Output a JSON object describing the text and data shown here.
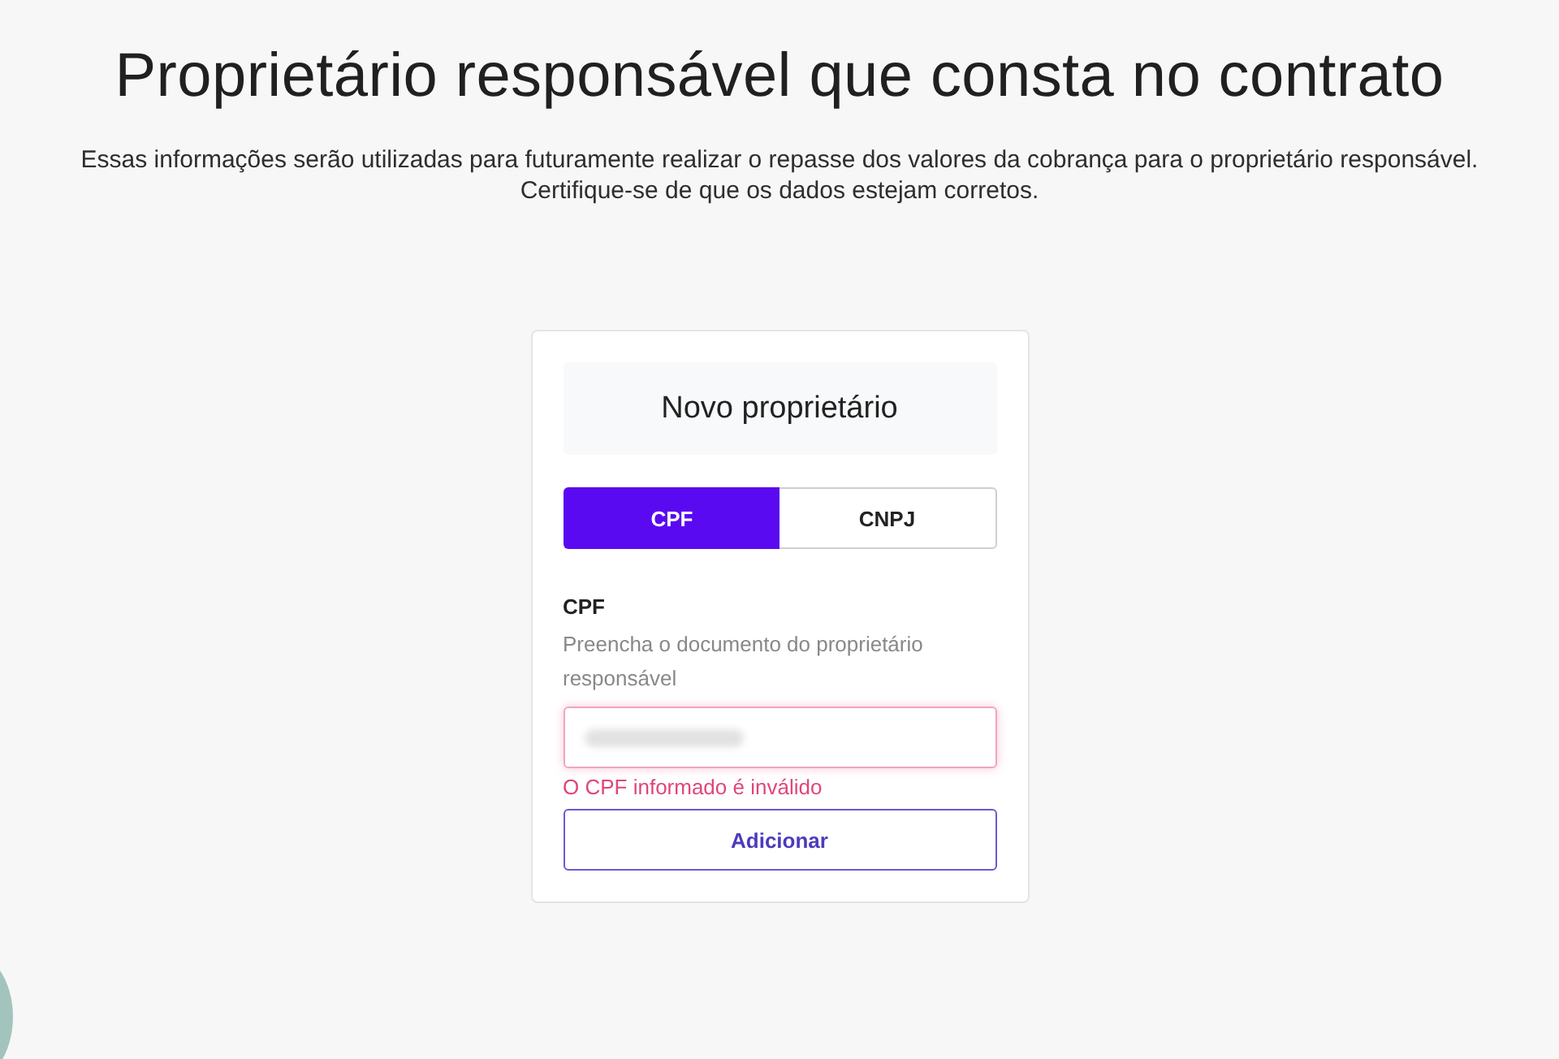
{
  "page": {
    "title": "Proprietário responsável que consta no contrato",
    "description": [
      "Essas informações serão utilizadas para futuramente realizar o repasse dos valores da cobrança para o proprietário responsável.",
      "Certifique-se de que os dados estejam corretos."
    ]
  },
  "card": {
    "title": "Novo proprietário",
    "document_types": [
      {
        "label": "CPF",
        "selected": true
      },
      {
        "label": "CNPJ",
        "selected": false
      }
    ],
    "field": {
      "label": "CPF",
      "hint": "Preencha o documento do proprietário responsável",
      "value_blurred": true,
      "invalid": true,
      "error": "O CPF informado é inválido"
    },
    "button": "Adicionar"
  }
}
